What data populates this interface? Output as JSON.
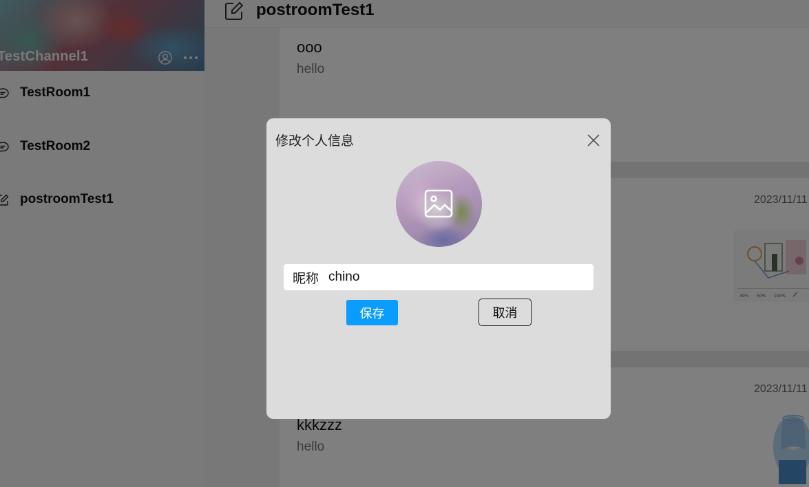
{
  "sidebar": {
    "channel_name": "TestChannel1",
    "icons": [
      "user-icon",
      "more-icon"
    ],
    "rooms": [
      {
        "label": "TestRoom1",
        "icon": "chat-bubble-icon"
      },
      {
        "label": "TestRoom2",
        "icon": "chat-bubble-icon"
      },
      {
        "label": "postroomTest1",
        "icon": "edit-icon"
      }
    ]
  },
  "header": {
    "title": "postroomTest1",
    "icon": "edit-icon"
  },
  "posts": [
    {
      "title": "ooo",
      "body": "hello",
      "date": ""
    },
    {
      "title": "",
      "body": "",
      "date": "2023/11/11"
    },
    {
      "title": "kkkzzz",
      "body": "hello",
      "date": "2023/11/11"
    }
  ],
  "dialog": {
    "title": "修改个人信息",
    "close_icon": "close-icon",
    "avatar_icon": "image-icon",
    "nickname_label": "昵称",
    "nickname_value": "chino",
    "save_label": "保存",
    "cancel_label": "取消"
  },
  "colors": {
    "primary": "#0b9cff",
    "overlay": "rgba(0,0,0,0.5)",
    "dialog_bg": "#dcdcdc"
  }
}
